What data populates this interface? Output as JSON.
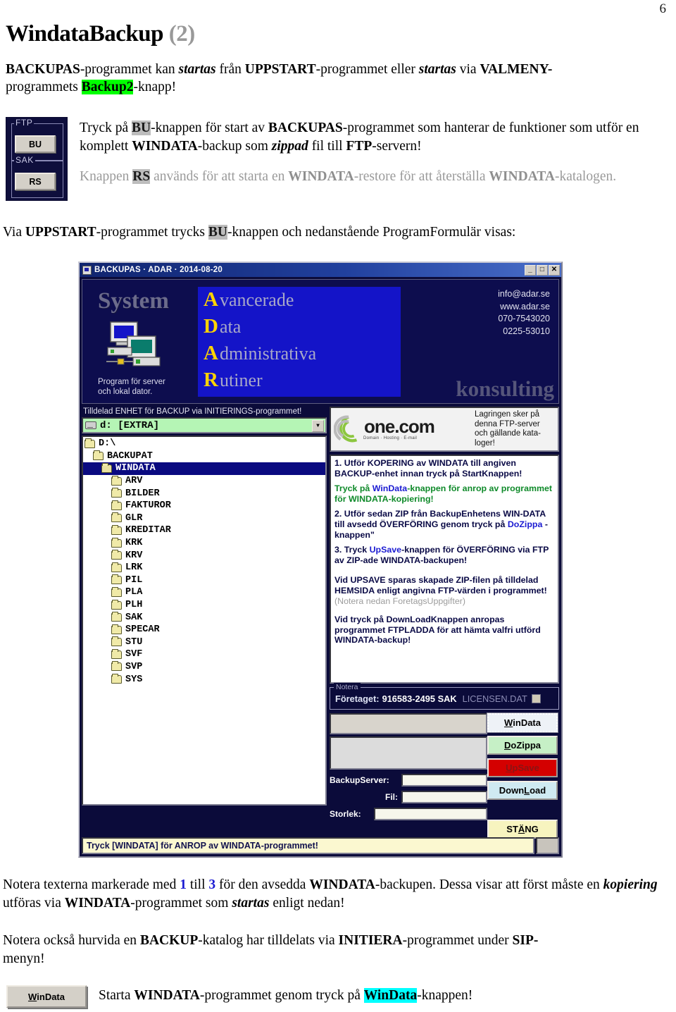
{
  "page": {
    "number": "6"
  },
  "doc": {
    "title_main": "WindataBackup",
    "title_paren": "(2)",
    "intro": {
      "l1_a": "BACKUPAS",
      "l1_b": "-programmet kan ",
      "l1_c": "startas",
      "l1_d": " från ",
      "l1_e": "UPPSTART",
      "l1_f": "-programmet eller ",
      "l1_g": "startas",
      "l1_h": " via ",
      "l1_i": "VALMENY-",
      "l2_a": "programmets ",
      "l2_b": "Backup2",
      "l2_c": "-knapp!"
    },
    "para_bu": {
      "a": "Tryck på ",
      "b": "BU",
      "c": "-knappen för start av ",
      "d": "BACKUPAS",
      "e": "-programmet som hanterar de funktioner som utför en komplett ",
      "f": "WINDATA",
      "g": "-backup som ",
      "h": "zippad",
      "i": " fil till ",
      "j": "FTP",
      "k": "-servern!"
    },
    "para_rs": {
      "a": "Knappen ",
      "b": "RS",
      "c": " används för att starta en ",
      "d": "WINDATA",
      "e": "-restore för att återställa ",
      "f": "WINDATA",
      "g": "-katalogen."
    },
    "para_via": {
      "a": "Via ",
      "b": "UPPSTART",
      "c": "-programmet trycks ",
      "d": "BU",
      "e": "-knappen och nedanstående ProgramFormulär visas:"
    },
    "para_notera1": {
      "a": "Notera texterna markerade med ",
      "b": "1",
      "c": " till ",
      "d": "3",
      "e": " för den avsedda ",
      "f": "WINDATA",
      "g": "-backupen. Dessa visar att först måste en ",
      "h": "kopiering",
      "i": " utföras via ",
      "j": "WINDATA",
      "k": "-programmet som ",
      "l": "startas",
      "m": " enligt nedan!"
    },
    "para_notera2": {
      "a": "Notera också hurvida en ",
      "b": "BACKUP",
      "c": "-katalog har tilldelats via ",
      "d": "INITIERA",
      "e": "-programmet under ",
      "f": "SIP-",
      "g": "menyn!"
    },
    "para_start": {
      "a": "Starta ",
      "b": "WINDATA",
      "c": "-programmet genom tryck på ",
      "d": "WinData",
      "e": "-knappen!"
    },
    "bottom_button": {
      "label_u": "W",
      "label_rest": "inData"
    }
  },
  "ftp_panel": {
    "group1_label": "FTP",
    "group2_label": "SAK",
    "button1": "BU",
    "button2": "RS"
  },
  "app": {
    "titlebar": {
      "text": "BACKUPAS · ADAR · 2014-08-20",
      "minimize": "_",
      "maximize": "□",
      "close": "✕"
    },
    "banner": {
      "system_word": "System",
      "system_sub_l1": "Program för server",
      "system_sub_l2": "och lokal dator.",
      "adar": [
        {
          "cap": "A",
          "rest": "vancerade"
        },
        {
          "cap": "D",
          "rest": "ata"
        },
        {
          "cap": "A",
          "rest": "dministrativa"
        },
        {
          "cap": "R",
          "rest": "utiner"
        }
      ],
      "contact": [
        "info@adar.se",
        "www.adar.se",
        "070-7543020",
        "0225-53010"
      ],
      "konsulting": "konsulting"
    },
    "enhet_label": "Tilldelad ENHET för BACKUP via INITIERINGS-programmet!",
    "drive_combo": {
      "value": "d:  [EXTRA]",
      "arrow": "▼"
    },
    "tree": [
      {
        "label": "D:\\",
        "indent": 0,
        "selected": false
      },
      {
        "label": "BACKUPAT",
        "indent": 1,
        "selected": false
      },
      {
        "label": "WINDATA",
        "indent": 2,
        "selected": true
      },
      {
        "label": "ARV",
        "indent": 3,
        "selected": false
      },
      {
        "label": "BILDER",
        "indent": 3,
        "selected": false
      },
      {
        "label": "FAKTUROR",
        "indent": 3,
        "selected": false
      },
      {
        "label": "GLR",
        "indent": 3,
        "selected": false
      },
      {
        "label": "KREDITAR",
        "indent": 3,
        "selected": false
      },
      {
        "label": "KRK",
        "indent": 3,
        "selected": false
      },
      {
        "label": "KRV",
        "indent": 3,
        "selected": false
      },
      {
        "label": "LRK",
        "indent": 3,
        "selected": false
      },
      {
        "label": "PIL",
        "indent": 3,
        "selected": false
      },
      {
        "label": "PLA",
        "indent": 3,
        "selected": false
      },
      {
        "label": "PLH",
        "indent": 3,
        "selected": false
      },
      {
        "label": "SAK",
        "indent": 3,
        "selected": false
      },
      {
        "label": "SPECAR",
        "indent": 3,
        "selected": false
      },
      {
        "label": "STU",
        "indent": 3,
        "selected": false
      },
      {
        "label": "SVF",
        "indent": 3,
        "selected": false
      },
      {
        "label": "SVP",
        "indent": 3,
        "selected": false
      },
      {
        "label": "SYS",
        "indent": 3,
        "selected": false
      }
    ],
    "onecom": {
      "name": "one.com",
      "tagline": "Domain · Hosting · E-mail",
      "note_l1": "Lagringen sker på",
      "note_l2": "denna FTP-server",
      "note_l3": "och gällande kata-",
      "note_l4": "loger!"
    },
    "instructions": {
      "i1_a": "1. Utför KOPERING av WINDATA till angiven BACKUP-enhet innan tryck på StartKnappen!",
      "i2_a": "Tryck på ",
      "i2_b": "WinData",
      "i2_c": "-knappen för anrop av programmet för WINDATA-kopiering!",
      "i3_a": "2. Utför sedan ZIP från BackupEnhetens WIN-DATA till avsedd ÖVERFÖRING genom tryck på ",
      "i3_b": "DoZippa",
      "i3_c": " -knappen\"",
      "i4_a": "3. Tryck ",
      "i4_b": "UpSave",
      "i4_c": "-knappen för ÖVERFÖRING via FTP av ZIP-ade WINDATA-backupen!",
      "i5_a": "Vid UPSAVE sparas skapade ZIP-filen på tilldelad HEMSIDA enligt angivna FTP-värden i programmet!",
      "i5_b": " (Notera nedan ForetagsUppgifter)",
      "i6_a": "Vid tryck på DownLoadKnappen anropas programmet FTPLADDA för att hämta valfri utförd WINDATA-backup!"
    },
    "notera": {
      "group_label": "Notera",
      "label": "Företaget:",
      "value": "916583-2495 SAK",
      "license": "LICENSEN.DAT"
    },
    "fields": {
      "backupserver_label": "BackupServer:",
      "backupserver_value": "",
      "fil_label": "Fil:",
      "fil_value": "",
      "storlek_label": "Storlek:",
      "storlek_value": ""
    },
    "buttons": {
      "windata": {
        "u": "W",
        "rest": "inData",
        "color": "#eef2f7"
      },
      "dozippa": {
        "u": "D",
        "rest": "oZippa",
        "color": "#c6f0c6"
      },
      "upsave": {
        "u": "U",
        "rest": "pSave",
        "color": "#d40000"
      },
      "download": {
        "u": "L",
        "pre": "Down",
        "rest": "oad",
        "color": "#cfeaf2"
      },
      "stang": {
        "u": "Ä",
        "pre": "ST",
        "rest": "NG",
        "color": "#f7f4bf"
      }
    },
    "statusbar": {
      "text": "Tryck [WINDATA] för ANROP av WINDATA-programmet!"
    }
  }
}
